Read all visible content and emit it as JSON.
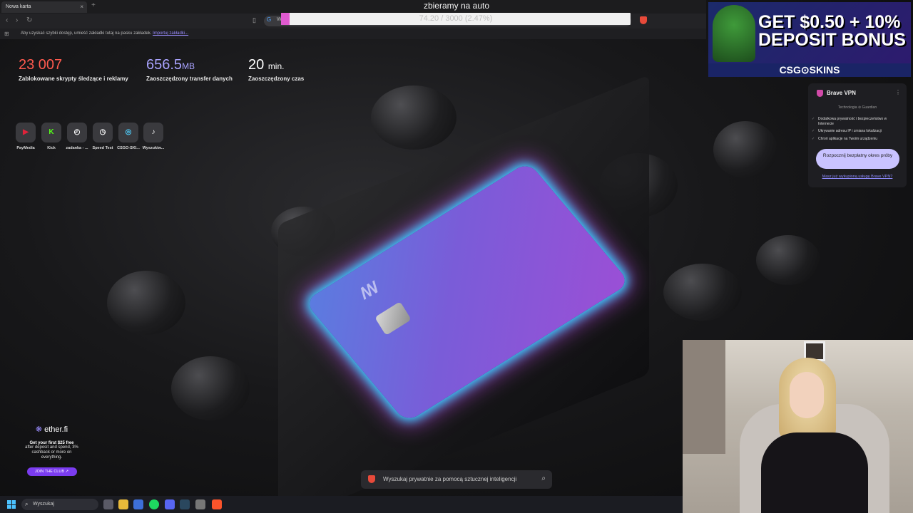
{
  "browser": {
    "tab_title": "Nowa karta",
    "tab_close": "×",
    "new_tab": "+",
    "omnibox_text": "W",
    "bookmark_bar_message": "Aby uzyskać szybki dostęp, umieść zakładki tutaj na pasku zakładek.",
    "bookmark_bar_link": "Importuj zakładki..."
  },
  "stream": {
    "title": "zbieramy na auto",
    "goal_text": "74.20 / 3000 (2.47%)",
    "goal_fraction": 0.0247
  },
  "stats": [
    {
      "value": "23 007",
      "unit": "",
      "label": "Zablokowane skrypty śledzące i reklamy",
      "color": "#ff5a4e"
    },
    {
      "value": "656.5",
      "unit": "MB",
      "label": "Zaoszczędzony transfer danych",
      "color": "#a9a3ff"
    },
    {
      "value": "20",
      "unit": "min.",
      "label": "Zaoszczędzony czas",
      "color": "#ffffff"
    }
  ],
  "shortcuts": [
    {
      "name": "PayMedia",
      "glyph": "▶",
      "color": "#e0233a"
    },
    {
      "name": "Kick",
      "glyph": "K",
      "color": "#53fc18"
    },
    {
      "name": "zadanka - ...",
      "glyph": "◴",
      "color": "#ffffff"
    },
    {
      "name": "Speed Test",
      "glyph": "◷",
      "color": "#ffffff"
    },
    {
      "name": "CSGO-SKI...",
      "glyph": "◎",
      "color": "#4fd1ff"
    },
    {
      "name": "Wyszukiw...",
      "glyph": "♪",
      "color": "#ffffff"
    }
  ],
  "ad": {
    "text": "GET $0.50 + 10% DEPOSIT BONUS",
    "brand": "CSG⊙SKINS"
  },
  "vpn": {
    "title": "Brave VPN",
    "tech": "Technologia ⊘ Guardian",
    "features": [
      "Dodatkowa prywatność i bezpieczeństwo w Internecie",
      "Ukrywanie adresu IP i zmiana lokalizacji",
      "Chroń aplikacje na Twoim urządzeniu"
    ],
    "button": "Rozpocznij bezpłatny okres próby",
    "link": "Masz już wykupioną usługę Brave VPN?"
  },
  "ether": {
    "logo": "ether.fi",
    "headline": "Get your first $25 free",
    "sub": "after deposit and spend, 3% cashback or more on everything.",
    "button": "JOIN THE CLUB ↗"
  },
  "card": {
    "logo": "ꟷ"
  },
  "ai_search": {
    "placeholder": "Wyszukaj prywatnie za pomocą sztucznej inteligencji"
  },
  "taskbar": {
    "search": "Wyszukaj"
  }
}
